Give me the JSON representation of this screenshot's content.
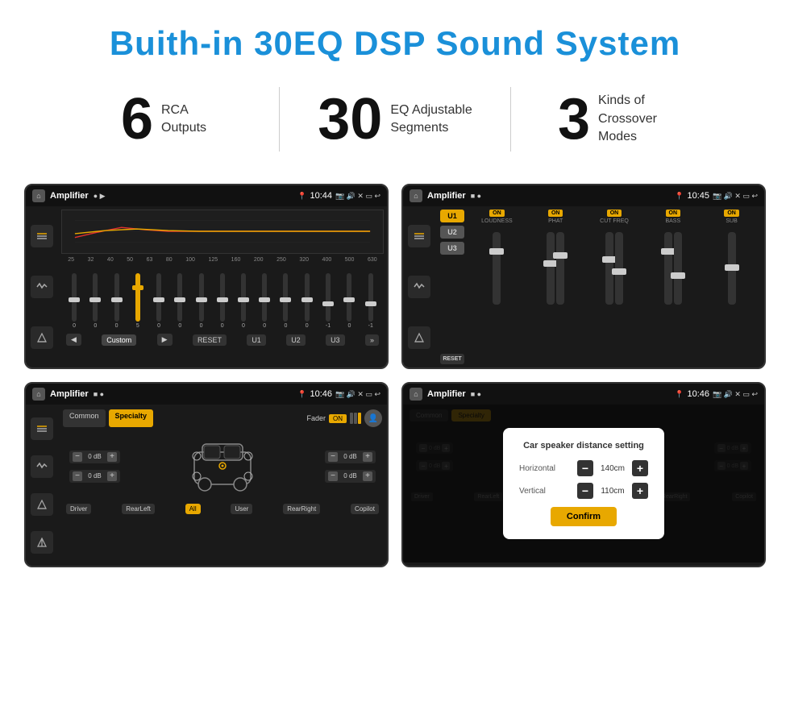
{
  "title": "Buith-in 30EQ DSP Sound System",
  "stats": [
    {
      "number": "6",
      "text_line1": "RCA",
      "text_line2": "Outputs"
    },
    {
      "number": "30",
      "text_line1": "EQ Adjustable",
      "text_line2": "Segments"
    },
    {
      "number": "3",
      "text_line1": "Kinds of",
      "text_line2": "Crossover Modes"
    }
  ],
  "screens": [
    {
      "id": "eq-screen",
      "status_bar": {
        "title": "Amplifier",
        "time": "10:44"
      }
    },
    {
      "id": "crossover-screen",
      "status_bar": {
        "title": "Amplifier",
        "time": "10:45"
      }
    },
    {
      "id": "speaker-fader-screen",
      "status_bar": {
        "title": "Amplifier",
        "time": "10:46"
      }
    },
    {
      "id": "distance-setting-screen",
      "status_bar": {
        "title": "Amplifier",
        "time": "10:46"
      },
      "dialog": {
        "title": "Car speaker distance setting",
        "horizontal_label": "Horizontal",
        "horizontal_value": "140cm",
        "vertical_label": "Vertical",
        "vertical_value": "110cm",
        "confirm_label": "Confirm"
      }
    }
  ],
  "eq_frequencies": [
    "25",
    "32",
    "40",
    "50",
    "63",
    "80",
    "100",
    "125",
    "160",
    "200",
    "250",
    "320",
    "400",
    "500",
    "630"
  ],
  "eq_values": [
    "0",
    "0",
    "0",
    "5",
    "0",
    "0",
    "0",
    "0",
    "0",
    "0",
    "0",
    "0",
    "-1",
    "0",
    "-1"
  ],
  "eq_presets": [
    "Custom",
    "RESET",
    "U1",
    "U2",
    "U3"
  ],
  "crossover_channels": [
    {
      "label": "LOUDNESS",
      "on": true
    },
    {
      "label": "PHAT",
      "on": true
    },
    {
      "label": "CUT FREQ",
      "on": true
    },
    {
      "label": "BASS",
      "on": true
    },
    {
      "label": "SUB",
      "on": true
    }
  ],
  "crossover_presets": [
    "U1",
    "U2",
    "U3"
  ],
  "fader": {
    "tabs": [
      "Common",
      "Specialty"
    ],
    "active_tab": "Specialty",
    "fader_label": "Fader",
    "fader_on": "ON",
    "db_values": [
      "0 dB",
      "0 dB",
      "0 dB",
      "0 dB"
    ],
    "bottom_labels": [
      "Driver",
      "RearLeft",
      "All",
      "User",
      "RearRight",
      "Copilot"
    ]
  },
  "distance_dialog": {
    "title": "Car speaker distance setting",
    "horizontal_label": "Horizontal",
    "horizontal_value": "140cm",
    "vertical_label": "Vertical",
    "vertical_value": "110cm",
    "confirm_label": "Confirm"
  },
  "icons": {
    "home": "⌂",
    "back": "↩",
    "location": "📍",
    "camera": "📷",
    "volume": "🔊",
    "close": "✕",
    "window": "▭",
    "settings": "⚙",
    "equalizer": "≡",
    "waveform": "〜",
    "speaker": "🔈",
    "tune": "🎛",
    "person": "👤",
    "play": "▶",
    "pause": "■",
    "prev": "◀",
    "next": "▶▶",
    "minus": "−",
    "plus": "+"
  }
}
